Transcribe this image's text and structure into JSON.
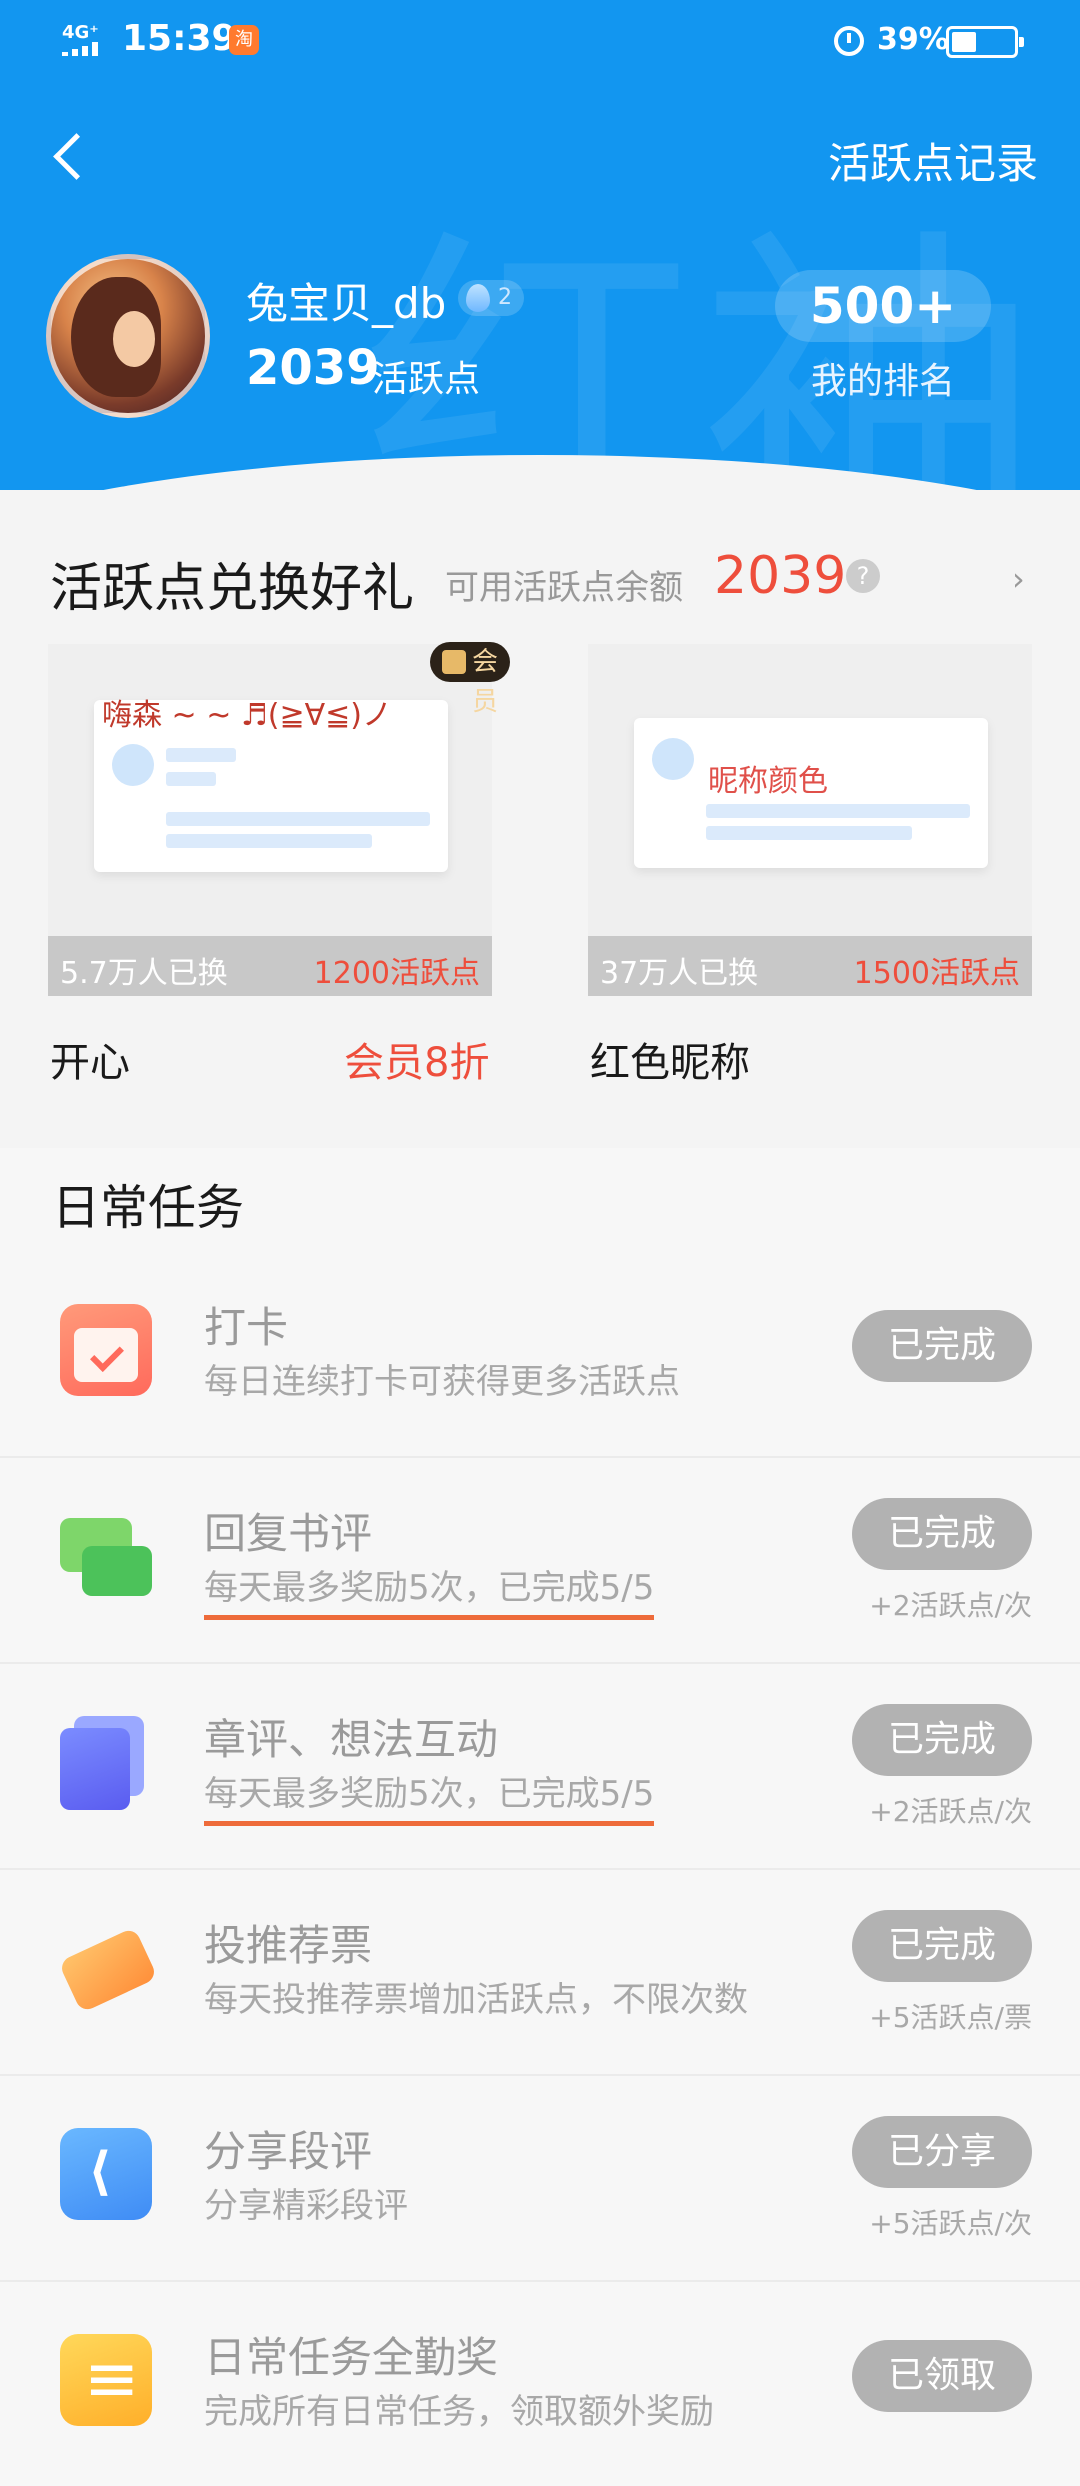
{
  "status_bar": {
    "network": "4G⁺",
    "time": "15:39",
    "app_badge": "淘",
    "battery_pct": "39%"
  },
  "header": {
    "record_link": "活跃点记录",
    "watermark": "红袖",
    "user": {
      "name": "兔宝贝_db",
      "level": "2",
      "points": "2039",
      "points_label": "活跃点"
    },
    "rank": {
      "value": "500+",
      "label": "我的排名"
    }
  },
  "exchange": {
    "title": "活跃点兑换好礼",
    "balance_label": "可用活跃点余额",
    "balance": "2039",
    "help": "?",
    "chevron": "›",
    "items": [
      {
        "name": "开心",
        "vip_badge": "会员",
        "preview_text": "嗨森 ~ ~ ♬(≧∀≦)ノ",
        "count": "5.7万人已换",
        "cost": "1200活跃点",
        "discount": "会员8折"
      },
      {
        "name": "红色昵称",
        "preview_text": "昵称颜色",
        "count": "37万人已换",
        "cost": "1500活跃点"
      }
    ]
  },
  "tasks": {
    "title": "日常任务",
    "items": [
      {
        "icon": "calendar-check-icon",
        "title": "打卡",
        "desc": "每日连续打卡可获得更多活跃点",
        "status": "已完成",
        "reward": ""
      },
      {
        "icon": "chat-bubbles-icon",
        "title": "回复书评",
        "desc": "每天最多奖励5次，已完成5/5",
        "status": "已完成",
        "reward": "+2活跃点/次"
      },
      {
        "icon": "document-stack-icon",
        "title": "章评、想法互动",
        "desc": "每天最多奖励5次，已完成5/5",
        "status": "已完成",
        "reward": "+2活跃点/次"
      },
      {
        "icon": "ticket-icon",
        "title": "投推荐票",
        "desc": "每天投推荐票增加活跃点，不限次数",
        "status": "已完成",
        "reward": "+5活跃点/票"
      },
      {
        "icon": "share-icon",
        "title": "分享段评",
        "desc": "分享精彩段评",
        "status": "已分享",
        "reward": "+5活跃点/次"
      },
      {
        "icon": "checklist-icon",
        "title": "日常任务全勤奖",
        "desc": "完成所有日常任务，领取额外奖励",
        "status": "已领取",
        "reward": ""
      }
    ]
  }
}
